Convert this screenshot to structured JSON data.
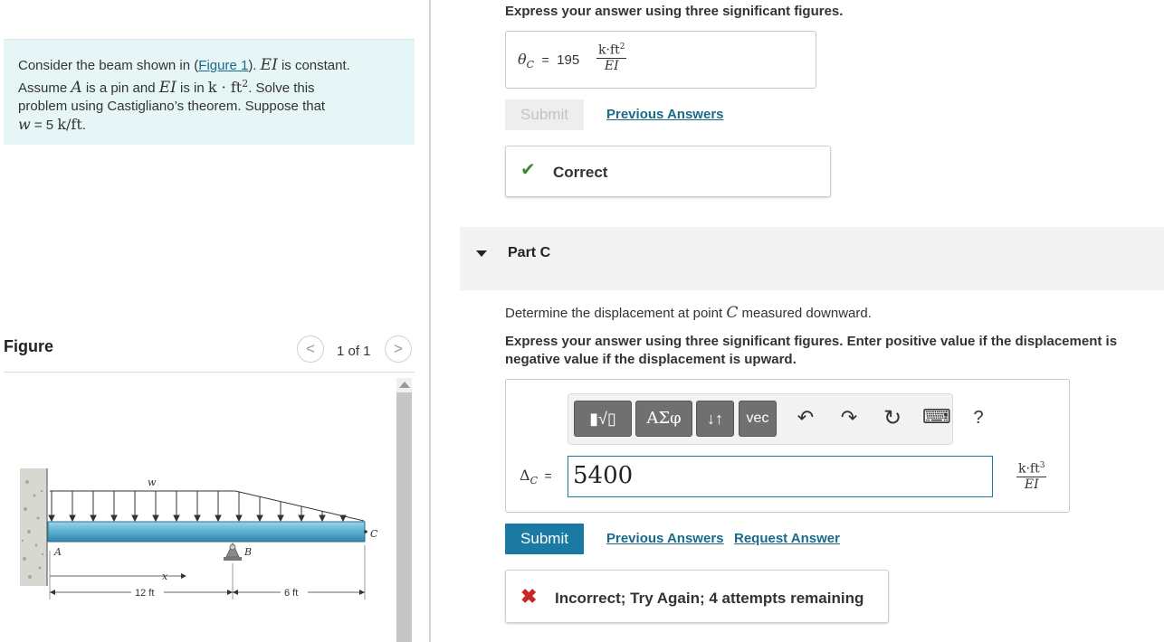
{
  "problem": {
    "line1_pre": "Consider the beam shown in (",
    "figure_link": "Figure 1",
    "line1_post": ").",
    "ei": "EI",
    "is_constant": "is constant.",
    "assume": "Assume",
    "A": "A",
    "is_pin_and": "is a pin and",
    "is_in": "is in",
    "unit": "k · ft",
    "unit_exp": "2",
    "solve": ". Solve this",
    "line3": "problem using Castigliano’s theorem. Suppose that",
    "w": "w",
    "w_value": "= 5",
    "w_unit": "k/ft",
    "w_end": "."
  },
  "figure": {
    "title": "Figure",
    "counter": "1 of 1",
    "prev": "<",
    "next": ">",
    "labels": {
      "w": "w",
      "A": "A",
      "B": "B",
      "C": "C",
      "x": "x",
      "dim1": "12 ft",
      "dim2": "6 ft"
    }
  },
  "partB": {
    "instruction": "Express your answer using three significant figures.",
    "theta_symbol": "θ",
    "theta_sub": "C",
    "equals": "=",
    "value": "195",
    "unit_num": "k·ft",
    "unit_num_exp": "2",
    "unit_den": "EI",
    "submit": "Submit",
    "previous_answers": "Previous Answers",
    "feedback": "Correct",
    "feedback_color": "#3a8a2e"
  },
  "partC": {
    "title": "Part C",
    "question_pre": "Determine the displacement at point",
    "question_C": "C",
    "question_post": "measured downward.",
    "instruction_line1": "Express your answer using three significant figures. Enter positive value if the displacement is",
    "instruction_line2": "negative value if the displacement is upward.",
    "toolbar": {
      "templates": "▮√▯",
      "greek": "ΑΣφ",
      "arrows": "↓↑",
      "vec": "vec",
      "undo": "↶",
      "redo": "↷",
      "reset": "↻",
      "keyboard": "⌨",
      "help": "?"
    },
    "delta_symbol": "Δ",
    "delta_sub": "C",
    "equals": "=",
    "input_value": "5400",
    "unit_num": "k·ft",
    "unit_num_exp": "3",
    "unit_den": "EI",
    "submit": "Submit",
    "previous_answers": "Previous Answers",
    "request_answer": "Request Answer",
    "feedback": "Incorrect; Try Again; 4 attempts remaining",
    "feedback_color": "#c62828"
  }
}
